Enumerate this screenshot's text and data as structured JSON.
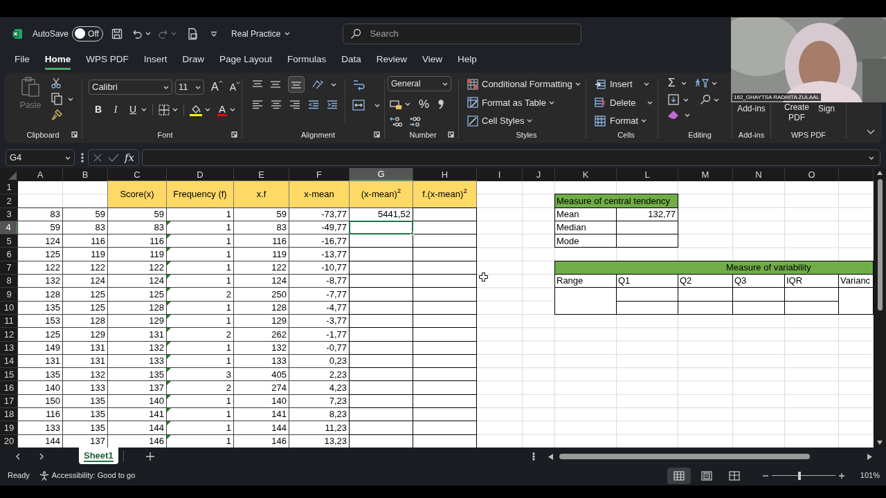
{
  "title_bar": {
    "autosave_label": "AutoSave",
    "autosave": {
      "on": false,
      "label": "Off"
    },
    "document": "Real Practice",
    "search": {
      "placeholder": "Search"
    }
  },
  "menu_tabs": [
    {
      "label": "File",
      "selected": false
    },
    {
      "label": "Home",
      "selected": true
    },
    {
      "label": "WPS PDF",
      "selected": false
    },
    {
      "label": "Insert",
      "selected": false
    },
    {
      "label": "Draw",
      "selected": false
    },
    {
      "label": "Page Layout",
      "selected": false
    },
    {
      "label": "Formulas",
      "selected": false
    },
    {
      "label": "Data",
      "selected": false
    },
    {
      "label": "Review",
      "selected": false
    },
    {
      "label": "View",
      "selected": false
    },
    {
      "label": "Help",
      "selected": false
    }
  ],
  "ribbon": {
    "clipboard": {
      "paste": "Paste",
      "paste_disabled": true,
      "label": "Clipboard"
    },
    "font": {
      "font": "Calibri",
      "size": "11",
      "grow": "A",
      "shrink": "A",
      "bold": "B",
      "italic": "I",
      "underline": "U",
      "font_color_letter": "A",
      "label": "Font"
    },
    "alignment": {
      "label": "Alignment"
    },
    "number": {
      "format": "General",
      "percent": "%",
      "label": "Number"
    },
    "styles": {
      "items": [
        "Conditional Formatting",
        "Format as Table",
        "Cell Styles"
      ],
      "label": "Styles"
    },
    "cells": {
      "items": [
        "Insert",
        "Delete",
        "Format"
      ],
      "label": "Cells"
    },
    "editing": {
      "autosum": "Σ",
      "label": "Editing"
    },
    "addins": {
      "button": "Add-ins",
      "label": "Add-ins"
    },
    "wps_pdf": {
      "create": "Create PDF",
      "sign": "Sign",
      "label": "WPS PDF"
    }
  },
  "video": {
    "participant": "162_GHAYTSA RADHITA ZULAAL"
  },
  "formula_bar": {
    "name_box": "G4",
    "fx": "fx"
  },
  "sheet": {
    "columns": [
      {
        "label": "A",
        "selected": false
      },
      {
        "label": "B",
        "selected": false
      },
      {
        "label": "C",
        "selected": false
      },
      {
        "label": "D",
        "selected": false
      },
      {
        "label": "E",
        "selected": false
      },
      {
        "label": "F",
        "selected": false
      },
      {
        "label": "G",
        "selected": true
      },
      {
        "label": "H",
        "selected": false
      },
      {
        "label": "I",
        "selected": false
      },
      {
        "label": "J",
        "selected": false
      },
      {
        "label": "K",
        "selected": false
      },
      {
        "label": "L",
        "selected": false
      },
      {
        "label": "M",
        "selected": false
      },
      {
        "label": "N",
        "selected": false
      },
      {
        "label": "O",
        "selected": false
      }
    ],
    "rows": [
      {
        "label": "1",
        "selected": false
      },
      {
        "label": "2",
        "selected": false
      },
      {
        "label": "3",
        "selected": false
      },
      {
        "label": "4",
        "selected": true
      },
      {
        "label": "5",
        "selected": false
      },
      {
        "label": "6",
        "selected": false
      },
      {
        "label": "7",
        "selected": false
      },
      {
        "label": "8",
        "selected": false
      },
      {
        "label": "9",
        "selected": false
      },
      {
        "label": "10",
        "selected": false
      },
      {
        "label": "11",
        "selected": false
      },
      {
        "label": "12",
        "selected": false
      },
      {
        "label": "13",
        "selected": false
      },
      {
        "label": "14",
        "selected": false
      },
      {
        "label": "15",
        "selected": false
      },
      {
        "label": "16",
        "selected": false
      },
      {
        "label": "17",
        "selected": false
      },
      {
        "label": "18",
        "selected": false
      },
      {
        "label": "19",
        "selected": false
      },
      {
        "label": "20",
        "selected": false
      }
    ],
    "data_table": {
      "headers": [
        "Score(x)",
        "Frequency (f)",
        "x.f",
        "x-mean",
        "(x-mean)$^{2}$",
        "f.(x-mean)$^{2}$"
      ],
      "rows": [
        {
          "values": [
            "83",
            "59",
            "59",
            "1",
            "59",
            "-73,77",
            "5441,52"
          ],
          "flagged": false
        },
        {
          "values": [
            "59",
            "83",
            "83",
            "1",
            "83",
            "-49,77"
          ],
          "flagged": true
        },
        {
          "values": [
            "124",
            "116",
            "116",
            "1",
            "116",
            "-16,77"
          ],
          "flagged": true
        },
        {
          "values": [
            "125",
            "119",
            "119",
            "1",
            "119",
            "-13,77"
          ],
          "flagged": true
        },
        {
          "values": [
            "122",
            "122",
            "122",
            "1",
            "122",
            "-10,77"
          ],
          "flagged": true
        },
        {
          "values": [
            "132",
            "124",
            "124",
            "1",
            "124",
            "-8,77"
          ],
          "flagged": true
        },
        {
          "values": [
            "128",
            "125",
            "125",
            "2",
            "250",
            "-7,77"
          ],
          "flagged": true
        },
        {
          "values": [
            "135",
            "125",
            "128",
            "1",
            "128",
            "-4,77"
          ],
          "flagged": true
        },
        {
          "values": [
            "153",
            "128",
            "129",
            "1",
            "129",
            "-3,77"
          ],
          "flagged": true
        },
        {
          "values": [
            "125",
            "129",
            "131",
            "2",
            "262",
            "-1,77"
          ],
          "flagged": true
        },
        {
          "values": [
            "149",
            "131",
            "132",
            "1",
            "132",
            "-0,77"
          ],
          "flagged": true
        },
        {
          "values": [
            "131",
            "131",
            "133",
            "1",
            "133",
            "0,23"
          ],
          "flagged": true
        },
        {
          "values": [
            "135",
            "132",
            "135",
            "3",
            "405",
            "2,23"
          ],
          "flagged": true
        },
        {
          "values": [
            "140",
            "133",
            "137",
            "2",
            "274",
            "4,23"
          ],
          "flagged": true
        },
        {
          "values": [
            "150",
            "135",
            "140",
            "1",
            "140",
            "7,23"
          ],
          "flagged": true
        },
        {
          "values": [
            "116",
            "135",
            "141",
            "1",
            "141",
            "8,23"
          ],
          "flagged": true
        },
        {
          "values": [
            "133",
            "135",
            "144",
            "1",
            "144",
            "11,23"
          ],
          "flagged": true
        },
        {
          "values": [
            "144",
            "137",
            "146",
            "1",
            "146",
            "13,23"
          ],
          "flagged": true
        }
      ]
    },
    "central_tendency": {
      "title": "Measure of central tendency",
      "rows": [
        {
          "label": "Mean",
          "value": "132,77"
        },
        {
          "label": "Median"
        },
        {
          "label": "Mode"
        }
      ]
    },
    "variability": {
      "title": "Measure of variability",
      "columns": [
        "Range",
        "Q1",
        "Q2",
        "Q3",
        "IQR",
        "Varianc"
      ]
    }
  },
  "sheet_tabs": [
    {
      "label": "Sheet1",
      "selected": true
    }
  ],
  "status_bar": {
    "ready": "Ready",
    "accessibility": "Accessibility: Good to go",
    "views": [
      {
        "kind": "normal",
        "selected": true
      },
      {
        "kind": "page-layout",
        "selected": false
      },
      {
        "kind": "page-break",
        "selected": false
      }
    ],
    "zoom": {
      "level": 0.44,
      "reading": "101%"
    }
  }
}
